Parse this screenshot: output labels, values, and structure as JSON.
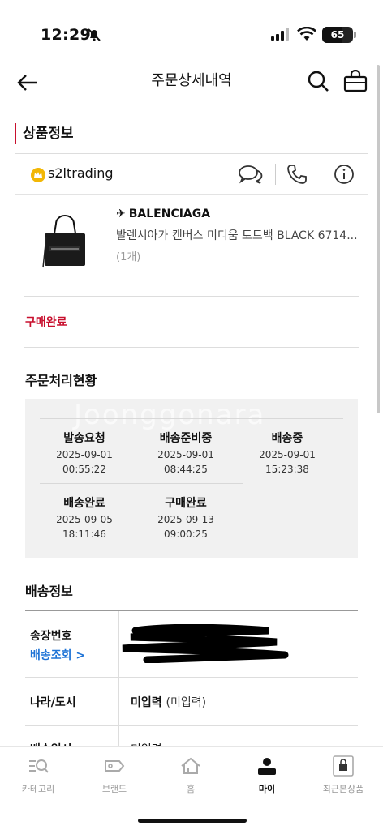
{
  "status_bar": {
    "time": "12:29",
    "battery": "65"
  },
  "header": {
    "title": "주문상세내역"
  },
  "section_product_title": "상품정보",
  "seller": {
    "name": "s2ltrading"
  },
  "product": {
    "brand": "BALENCIAGA",
    "name": "발렌시아가 캔버스 미디움 토트백 BLACK 6714...",
    "quantity": "(1개)"
  },
  "order_status": "구매완료",
  "processing": {
    "title": "주문처리현황",
    "watermark": "Joonggonara",
    "steps": [
      {
        "label": "발송요청",
        "date": "2025-09-01",
        "time": "00:55:22"
      },
      {
        "label": "배송준비중",
        "date": "2025-09-01",
        "time": "08:44:25"
      },
      {
        "label": "배송중",
        "date": "2025-09-01",
        "time": "15:23:38"
      },
      {
        "label": "배송완료",
        "date": "2025-09-05",
        "time": "18:11:46"
      },
      {
        "label": "구매완료",
        "date": "2025-09-13",
        "time": "09:00:25"
      }
    ]
  },
  "shipping": {
    "title": "배송정보",
    "invoice_label": "송장번호",
    "track_link": "배송조회 >",
    "country_label": "나라/도시",
    "country_value": "미입력",
    "country_value_paren": "(미입력)",
    "next_label": "배송일시",
    "next_value": "미입력"
  },
  "tabbar": [
    {
      "label": "카테고리"
    },
    {
      "label": "브랜드"
    },
    {
      "label": "홈"
    },
    {
      "label": "마이"
    },
    {
      "label": "최근본상품"
    }
  ],
  "colors": {
    "accent": "#c8102e",
    "link": "#1e73d6"
  }
}
